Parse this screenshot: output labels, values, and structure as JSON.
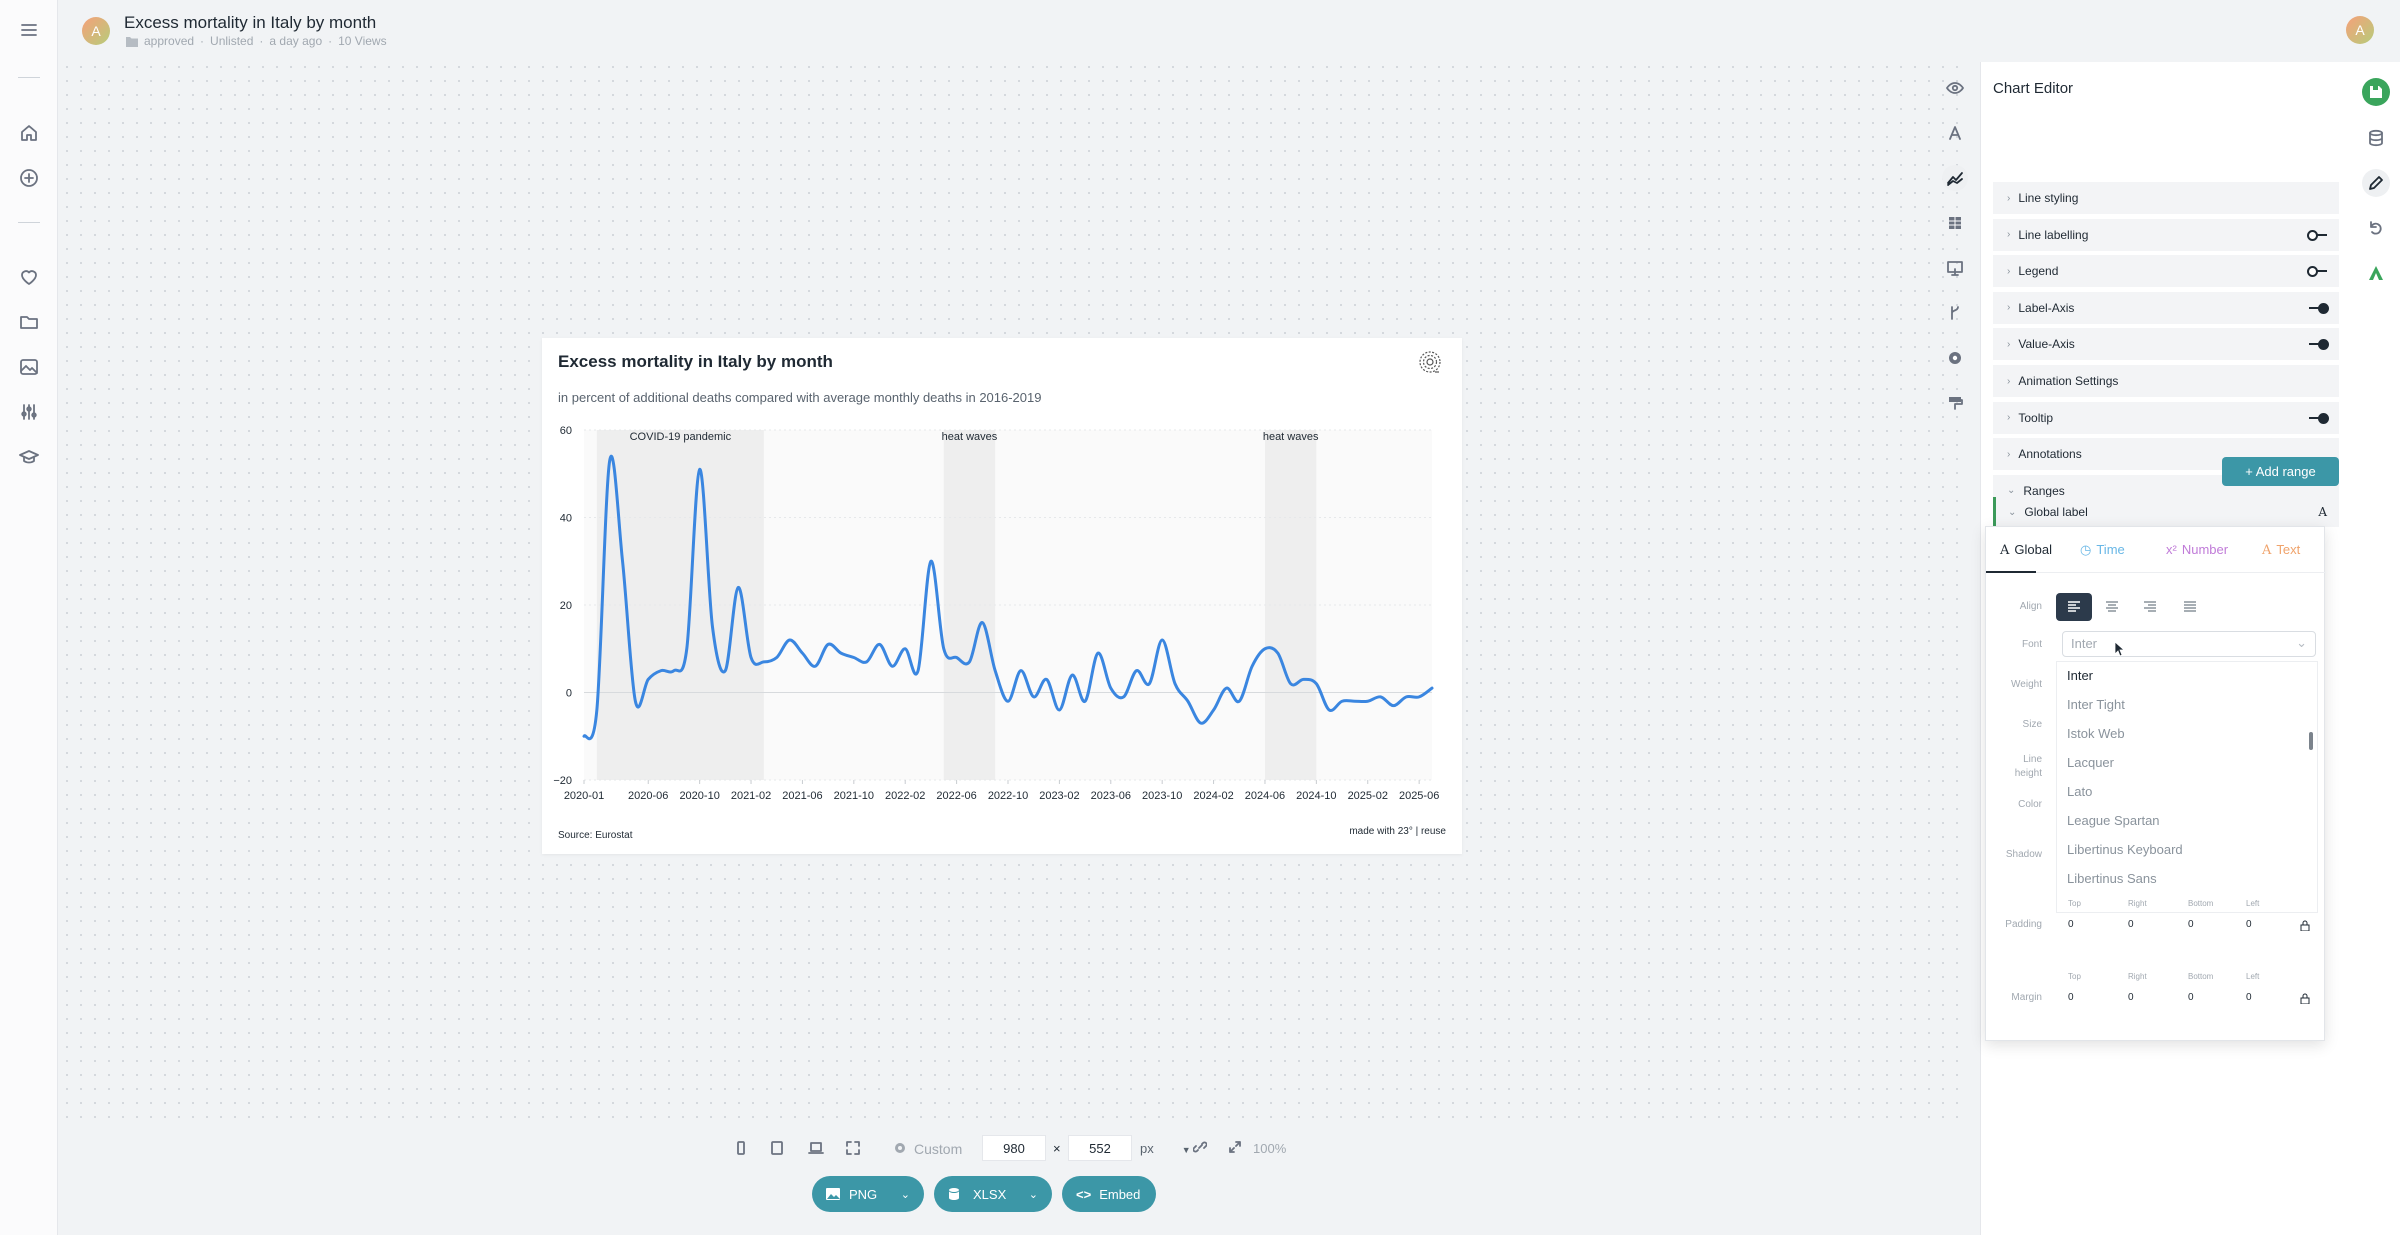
{
  "header": {
    "avatar_initial": "A",
    "title": "Excess mortality in Italy by month",
    "status": "approved",
    "visibility": "Unlisted",
    "updated": "a day ago",
    "views": "10 Views",
    "user_initial": "A"
  },
  "sidebar": {
    "items": [
      "menu-icon",
      "home-icon",
      "add-icon",
      "favorites-icon",
      "folder-icon",
      "image-icon",
      "adjustments-icon",
      "learn-icon"
    ]
  },
  "chart": {
    "title": "Excess mortality in Italy by month",
    "subtitle": "in percent of additional deaths compared with average monthly deaths in 2016-2019",
    "source": "Source: Eurostat",
    "credit": "made with 23° | reuse"
  },
  "chart_data": {
    "type": "line",
    "ylim": [
      -20,
      60
    ],
    "yticks": [
      "60",
      "40",
      "20",
      "0",
      "−20"
    ],
    "x_tick_labels": [
      "2020-01",
      "2020-06",
      "2020-10",
      "2021-02",
      "2021-06",
      "2021-10",
      "2022-02",
      "2022-06",
      "2022-10",
      "2023-02",
      "2023-06",
      "2023-10",
      "2024-02",
      "2024-06",
      "2024-10",
      "2025-02",
      "2025-06"
    ],
    "x_start": "2020-01",
    "x_end": "2025-07",
    "ranges": [
      {
        "label": "COVID-19 pandemic",
        "from": "2020-02",
        "to": "2021-03"
      },
      {
        "label": "heat waves",
        "from": "2022-05",
        "to": "2022-09"
      },
      {
        "label": "heat waves",
        "from": "2024-06",
        "to": "2024-10"
      }
    ],
    "series": [
      {
        "color": "#3a86e0",
        "months": [
          "2020-01",
          "2020-02",
          "2020-03",
          "2020-04",
          "2020-05",
          "2020-06",
          "2020-07",
          "2020-08",
          "2020-09",
          "2020-10",
          "2020-11",
          "2020-12",
          "2021-01",
          "2021-02",
          "2021-03",
          "2021-04",
          "2021-05",
          "2021-06",
          "2021-07",
          "2021-08",
          "2021-09",
          "2021-10",
          "2021-11",
          "2021-12",
          "2022-01",
          "2022-02",
          "2022-03",
          "2022-04",
          "2022-05",
          "2022-06",
          "2022-07",
          "2022-08",
          "2022-09",
          "2022-10",
          "2022-11",
          "2022-12",
          "2023-01",
          "2023-02",
          "2023-03",
          "2023-04",
          "2023-05",
          "2023-06",
          "2023-07",
          "2023-08",
          "2023-09",
          "2023-10",
          "2023-11",
          "2023-12",
          "2024-01",
          "2024-02",
          "2024-03",
          "2024-04",
          "2024-05",
          "2024-06",
          "2024-07",
          "2024-08",
          "2024-09",
          "2024-10",
          "2024-11",
          "2024-12",
          "2025-01",
          "2025-02",
          "2025-03",
          "2025-04",
          "2025-05",
          "2025-06",
          "2025-07"
        ],
        "values": [
          -10,
          -4,
          53,
          30,
          -2,
          3,
          5,
          5,
          10,
          51,
          15,
          5,
          24,
          8,
          7,
          8,
          12,
          9,
          6,
          11,
          9,
          8,
          7,
          11,
          6,
          10,
          5,
          30,
          10,
          8,
          7,
          16,
          5,
          -2,
          5,
          -1,
          3,
          -4,
          4,
          -2,
          9,
          1,
          -1,
          5,
          2,
          12,
          2,
          -2,
          -7,
          -4,
          1,
          -2,
          6,
          10,
          9,
          2,
          3,
          2,
          -4,
          -2,
          -2,
          -2,
          -1,
          -3,
          -1,
          -1,
          1
        ]
      }
    ]
  },
  "right_rail": [
    "preview-icon",
    "typography-icon",
    "chart-type-icon",
    "table-icon",
    "embed-icon",
    "branch-icon",
    "settings-icon",
    "paint-icon"
  ],
  "editor": {
    "title": "Chart Editor",
    "sections": [
      {
        "label": "Line styling",
        "toggle": null
      },
      {
        "label": "Line labelling",
        "toggle": "off"
      },
      {
        "label": "Legend",
        "toggle": "off"
      },
      {
        "label": "Label-Axis",
        "toggle": "on"
      },
      {
        "label": "Value-Axis",
        "toggle": "on"
      },
      {
        "label": "Animation Settings",
        "toggle": null
      },
      {
        "label": "Tooltip",
        "toggle": "on"
      },
      {
        "label": "Annotations",
        "toggle": null
      },
      {
        "label": "Ranges",
        "toggle": null
      }
    ],
    "add_range": "+ Add range",
    "global_label": "Global label",
    "tabs": {
      "global": "Global",
      "time": "Time",
      "number": "Number",
      "text": "Text"
    },
    "labels": {
      "align": "Align",
      "font": "Font",
      "weight": "Weight",
      "size": "Size",
      "line_height": "Line height",
      "color": "Color",
      "shadow": "Shadow",
      "padding": "Padding",
      "margin": "Margin"
    },
    "font_placeholder": "Inter",
    "font_options": [
      "Inter",
      "Inter Tight",
      "Istok Web",
      "Lacquer",
      "Lato",
      "League Spartan",
      "Libertinus Keyboard",
      "Libertinus Sans"
    ],
    "padding": {
      "top": "0",
      "right": "0",
      "bottom": "0",
      "left": "0"
    },
    "margin": {
      "top": "0",
      "right": "0",
      "bottom": "0",
      "left": "0"
    },
    "side_headers": {
      "top": "Top",
      "right": "Right",
      "bottom": "Bottom",
      "left": "Left"
    }
  },
  "bottom": {
    "preset": "Custom",
    "width": "980",
    "height": "552",
    "unit": "px",
    "zoom": "100%",
    "png": "PNG",
    "xlsx": "XLSX",
    "embed": "Embed"
  }
}
